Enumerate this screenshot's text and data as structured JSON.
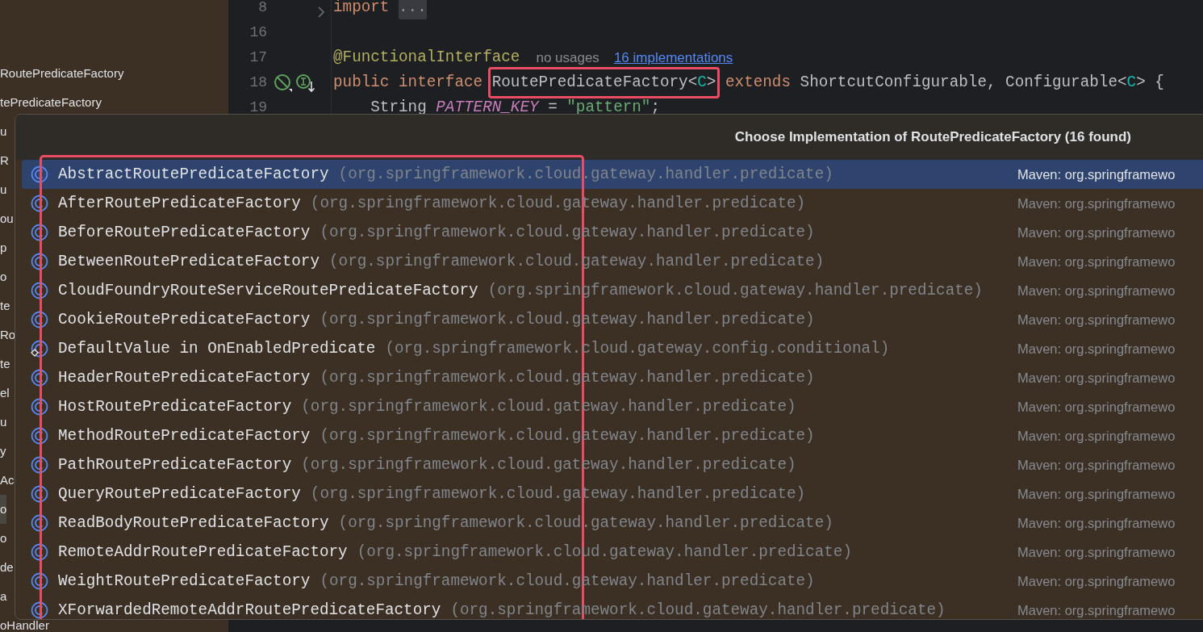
{
  "sidebar": {
    "items": [
      {
        "label": "RoutePredicateFactory",
        "selected": false
      },
      {
        "label": "tePredicateFactory",
        "selected": false
      },
      {
        "label": "u",
        "selected": false
      },
      {
        "label": "R",
        "selected": false
      },
      {
        "label": "u",
        "selected": false
      },
      {
        "label": "ou",
        "selected": false
      },
      {
        "label": "p",
        "selected": false
      },
      {
        "label": "o",
        "selected": false
      },
      {
        "label": "te",
        "selected": false
      },
      {
        "label": "Ro",
        "selected": false
      },
      {
        "label": "te",
        "selected": false
      },
      {
        "label": "el",
        "selected": false
      },
      {
        "label": "u",
        "selected": false
      },
      {
        "label": "y",
        "selected": false
      },
      {
        "label": "Ac",
        "selected": false
      },
      {
        "label": "o",
        "selected": true
      },
      {
        "label": "o",
        "selected": false
      },
      {
        "label": "de",
        "selected": false
      },
      {
        "label": "a",
        "selected": false
      },
      {
        "label": "oHandler",
        "selected": false
      }
    ]
  },
  "editor": {
    "lines": [
      {
        "number": "8",
        "foldable": true,
        "tokens": [
          {
            "kind": "keyword",
            "text": "import "
          },
          {
            "kind": "folded",
            "text": "..."
          }
        ]
      },
      {
        "number": "16",
        "foldable": false
      },
      {
        "number": "17",
        "foldable": false,
        "tokens": [
          {
            "kind": "annotation",
            "text": "@FunctionalInterface"
          },
          {
            "kind": "hint",
            "text": "no usages"
          },
          {
            "kind": "link",
            "text": "16 implementations"
          }
        ]
      },
      {
        "number": "18",
        "foldable": false,
        "gutter_icons": true,
        "tokens": [
          {
            "kind": "keyword",
            "text": "public interface "
          },
          {
            "kind": "highlight",
            "children": [
              {
                "kind": "plain",
                "text": "RoutePredicateFactory<"
              },
              {
                "kind": "type-param",
                "text": "C"
              },
              {
                "kind": "plain",
                "text": ">"
              }
            ]
          },
          {
            "kind": "keyword",
            "text": " extends "
          },
          {
            "kind": "plain",
            "text": "ShortcutConfigurable, Configurable<"
          },
          {
            "kind": "type-param",
            "text": "C"
          },
          {
            "kind": "plain",
            "text": "> {"
          }
        ]
      },
      {
        "number": "19",
        "foldable": false,
        "tokens": [
          {
            "kind": "plain",
            "text": "    String "
          },
          {
            "kind": "field",
            "text": "PATTERN_KEY"
          },
          {
            "kind": "plain",
            "text": " = "
          },
          {
            "kind": "string",
            "text": "\"pattern\""
          },
          {
            "kind": "plain",
            "text": ";"
          }
        ]
      }
    ]
  },
  "popup": {
    "title": "Choose Implementation of RoutePredicateFactory (16 found)",
    "items": [
      {
        "kind": "class",
        "name": "AbstractRoutePredicateFactory",
        "package": "(org.springframework.cloud.gateway.handler.predicate)",
        "library": "Maven: org.springframewo",
        "selected": true
      },
      {
        "kind": "class",
        "name": "AfterRoutePredicateFactory",
        "package": "(org.springframework.cloud.gateway.handler.predicate)",
        "library": "Maven: org.springframewo",
        "selected": false
      },
      {
        "kind": "class",
        "name": "BeforeRoutePredicateFactory",
        "package": "(org.springframework.cloud.gateway.handler.predicate)",
        "library": "Maven: org.springframewo",
        "selected": false
      },
      {
        "kind": "class",
        "name": "BetweenRoutePredicateFactory",
        "package": "(org.springframework.cloud.gateway.handler.predicate)",
        "library": "Maven: org.springframewo",
        "selected": false
      },
      {
        "kind": "class",
        "name": "CloudFoundryRouteServiceRoutePredicateFactory",
        "package": "(org.springframework.cloud.gateway.handler.predicate)",
        "library": "Maven: org.springframewo",
        "selected": false
      },
      {
        "kind": "class",
        "name": "CookieRoutePredicateFactory",
        "package": "(org.springframework.cloud.gateway.handler.predicate)",
        "library": "Maven: org.springframewo",
        "selected": false
      },
      {
        "kind": "method",
        "name": "DefaultValue in OnEnabledPredicate",
        "package": "(org.springframework.cloud.gateway.config.conditional)",
        "library": "Maven: org.springframewo",
        "selected": false
      },
      {
        "kind": "class",
        "name": "HeaderRoutePredicateFactory",
        "package": "(org.springframework.cloud.gateway.handler.predicate)",
        "library": "Maven: org.springframewo",
        "selected": false
      },
      {
        "kind": "class",
        "name": "HostRoutePredicateFactory",
        "package": "(org.springframework.cloud.gateway.handler.predicate)",
        "library": "Maven: org.springframewo",
        "selected": false
      },
      {
        "kind": "class",
        "name": "MethodRoutePredicateFactory",
        "package": "(org.springframework.cloud.gateway.handler.predicate)",
        "library": "Maven: org.springframewo",
        "selected": false
      },
      {
        "kind": "class",
        "name": "PathRoutePredicateFactory",
        "package": "(org.springframework.cloud.gateway.handler.predicate)",
        "library": "Maven: org.springframewo",
        "selected": false
      },
      {
        "kind": "class",
        "name": "QueryRoutePredicateFactory",
        "package": "(org.springframework.cloud.gateway.handler.predicate)",
        "library": "Maven: org.springframewo",
        "selected": false
      },
      {
        "kind": "class",
        "name": "ReadBodyRoutePredicateFactory",
        "package": "(org.springframework.cloud.gateway.handler.predicate)",
        "library": "Maven: org.springframewo",
        "selected": false
      },
      {
        "kind": "class",
        "name": "RemoteAddrRoutePredicateFactory",
        "package": "(org.springframework.cloud.gateway.handler.predicate)",
        "library": "Maven: org.springframewo",
        "selected": false
      },
      {
        "kind": "class",
        "name": "WeightRoutePredicateFactory",
        "package": "(org.springframework.cloud.gateway.handler.predicate)",
        "library": "Maven: org.springframewo",
        "selected": false
      },
      {
        "kind": "class",
        "name": "XForwardedRemoteAddrRoutePredicateFactory",
        "package": "(org.springframework.cloud.gateway.handler.predicate)",
        "library": "Maven: org.springframewo",
        "selected": false
      }
    ]
  }
}
